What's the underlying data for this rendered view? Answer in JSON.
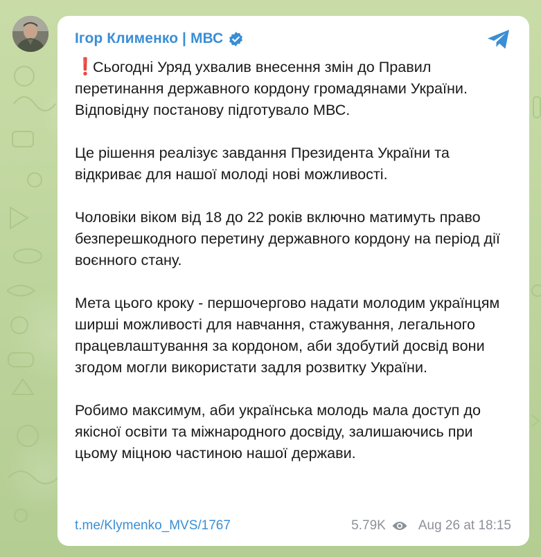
{
  "post": {
    "author": "Ігор Клименко | МВС",
    "emoji": "❗",
    "paragraphs": [
      "Сьогодні Уряд ухвалив внесення змін до Правил перетинання державного кордону громадянами України. Відповідну постанову підготувало МВС.",
      "Це рішення реалізує завдання Президента України та відкриває для нашої молоді нові можливості.",
      "Чоловіки віком від 18 до 22 років включно матимуть право безперешкодного перетину державного кордону на період дії воєнного стану.",
      "Мета цього кроку - першочергово надати молодим українцям ширші можливості для навчання, стажування, легального працевлаштування за кордоном, аби здобутий досвід вони згодом могли використати задля розвитку України.",
      "Робимо максимум, аби українська молодь мала доступ до якісної освіти та міжнародного досвіду, залишаючись при цьому міцною частиною нашої держави."
    ],
    "link": "t.me/Klymenko_MVS/1767",
    "views": "5.79K",
    "timestamp": "Aug 26 at 18:15"
  },
  "icons": {
    "verified": "verified-badge-icon",
    "share": "share-icon",
    "views": "eye-icon"
  },
  "colors": {
    "accent": "#3a8ed4",
    "background": "#c5d9a4",
    "bubble": "#ffffff",
    "meta": "#8d9199",
    "alert": "#d6232c"
  }
}
